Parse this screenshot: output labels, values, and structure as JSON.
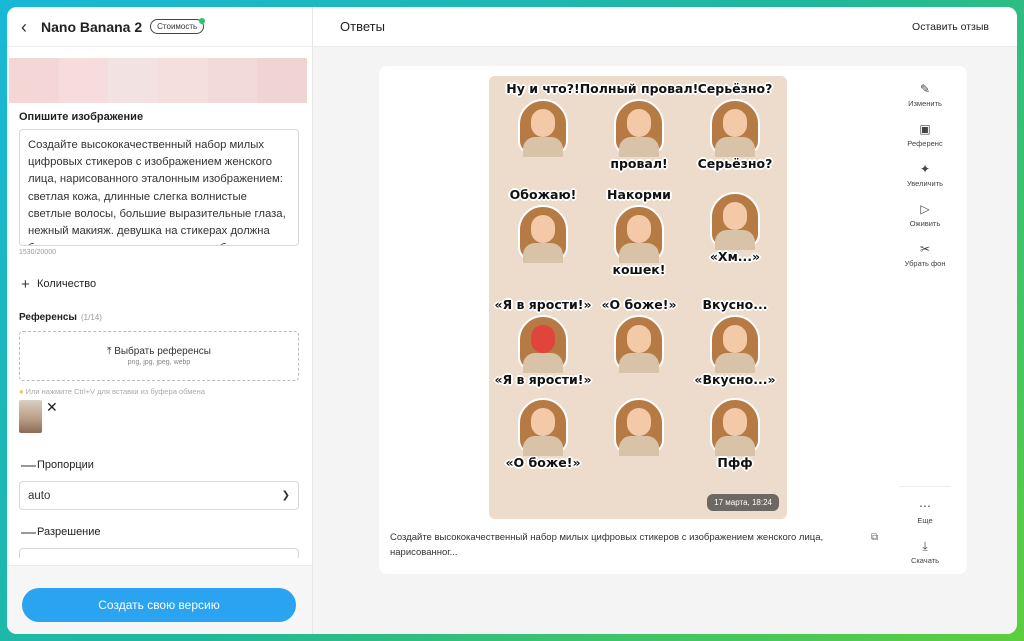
{
  "left_panel": {
    "back_icon": "chevron-left-icon",
    "model_title": "Nano Banana 2",
    "cost_badge": "Стоимость",
    "preview_colors": [
      "#f4d6d6",
      "#f6dcdc",
      "#f3e2e2",
      "#f5dede",
      "#f2dada",
      "#f0d3d3"
    ],
    "describe_label": "Опишите изображение",
    "prompt_text": "Создайте высококачественный набор милых цифровых стикеров с изображением женского лица, нарисованного эталонным изображением: светлая кожа, длинные слегка волнистые светлые волосы, большие выразительные глаза, нежный макияж. девушка на стикерах должна быть строго узнаваема, она должна быть",
    "counter": "1530/20000",
    "quantity_label": "Количество",
    "references_label": "Референсы",
    "references_count": "(1/14)",
    "upload_label": "Выбрать референсы",
    "upload_formats": "png, jpg, jpeg, webp",
    "paste_hint": "Или нажмите Ctrl+V для вставки из буфера обмена",
    "proportions_label": "Пропорции",
    "proportions_value": "auto",
    "resolution_label": "Разрешение",
    "create_button": "Создать свою версию"
  },
  "right_panel": {
    "title": "Ответы",
    "feedback_link": "Оставить отзыв",
    "stickers": [
      {
        "top": "Ну и что?!",
        "bottom": ""
      },
      {
        "top": "Полный провал!",
        "bottom": "провал!"
      },
      {
        "top": "Серьёзно?",
        "bottom": "Серьёзно?"
      },
      {
        "top": "Обожаю!",
        "bottom": ""
      },
      {
        "top": "Накорми",
        "bottom": "кошек!"
      },
      {
        "top": "",
        "bottom": "«Хм...»"
      },
      {
        "top": "«Я в ярости!»",
        "bottom": "«Я в ярости!»"
      },
      {
        "top": "«О боже!»",
        "bottom": ""
      },
      {
        "top": "Вкусно...",
        "bottom": "«Вкусно...»"
      },
      {
        "top": "",
        "bottom": "«О боже!»"
      },
      {
        "top": "",
        "bottom": ""
      },
      {
        "top": "",
        "bottom": "Пфф"
      }
    ],
    "timestamp": "17 марта, 18:24",
    "actions": [
      {
        "label": "Изменить",
        "icon": "pencil-icon"
      },
      {
        "label": "Референс",
        "icon": "image-icon"
      },
      {
        "label": "Увеличить",
        "icon": "sparkle-icon"
      },
      {
        "label": "Оживить",
        "icon": "play-icon"
      },
      {
        "label": "Убрать фон",
        "icon": "scissors-icon"
      }
    ],
    "actions_bottom": [
      {
        "label": "Еще",
        "icon": "more-icon"
      },
      {
        "label": "Скачать",
        "icon": "download-icon"
      }
    ],
    "caption": "Создайте высококачественный набор милых цифровых стикеров с изображением женского лица, нарисованног..."
  }
}
